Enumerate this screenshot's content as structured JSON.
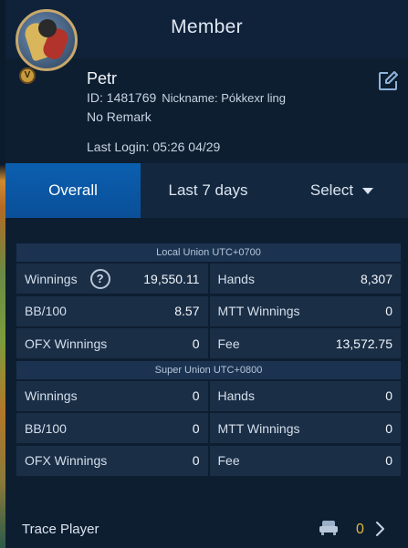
{
  "header": {
    "title": "Member"
  },
  "profile": {
    "name": "Petr",
    "id_line": "ID: 1481769",
    "nickname": "Nickname: Pókkexr ling",
    "remark": "No Remark",
    "last_login": "Last Login: 05:26 04/29",
    "badge": "V"
  },
  "tabs": {
    "overall": "Overall",
    "last7": "Last 7 days",
    "select": "Select"
  },
  "sections": [
    {
      "title": "Local Union UTC+0700",
      "rows": [
        [
          {
            "label": "Winnings",
            "value": "19,550.11"
          },
          {
            "label": "Hands",
            "value": "8,307"
          }
        ],
        [
          {
            "label": "BB/100",
            "value": "8.57"
          },
          {
            "label": "MTT Winnings",
            "value": "0"
          }
        ],
        [
          {
            "label": "OFX Winnings",
            "value": "0"
          },
          {
            "label": "Fee",
            "value": "13,572.75"
          }
        ]
      ]
    },
    {
      "title": "Super Union UTC+0800",
      "rows": [
        [
          {
            "label": "Winnings",
            "value": "0"
          },
          {
            "label": "Hands",
            "value": "0"
          }
        ],
        [
          {
            "label": "BB/100",
            "value": "0"
          },
          {
            "label": "MTT Winnings",
            "value": "0"
          }
        ],
        [
          {
            "label": "OFX Winnings",
            "value": "0"
          },
          {
            "label": "Fee",
            "value": "0"
          }
        ]
      ]
    }
  ],
  "help_glyph": "?",
  "trace": {
    "label": "Trace Player",
    "count": "0"
  },
  "colors": {
    "accent": "#0a5aa8",
    "background": "#0e1e31",
    "count": "#e0b83e"
  }
}
